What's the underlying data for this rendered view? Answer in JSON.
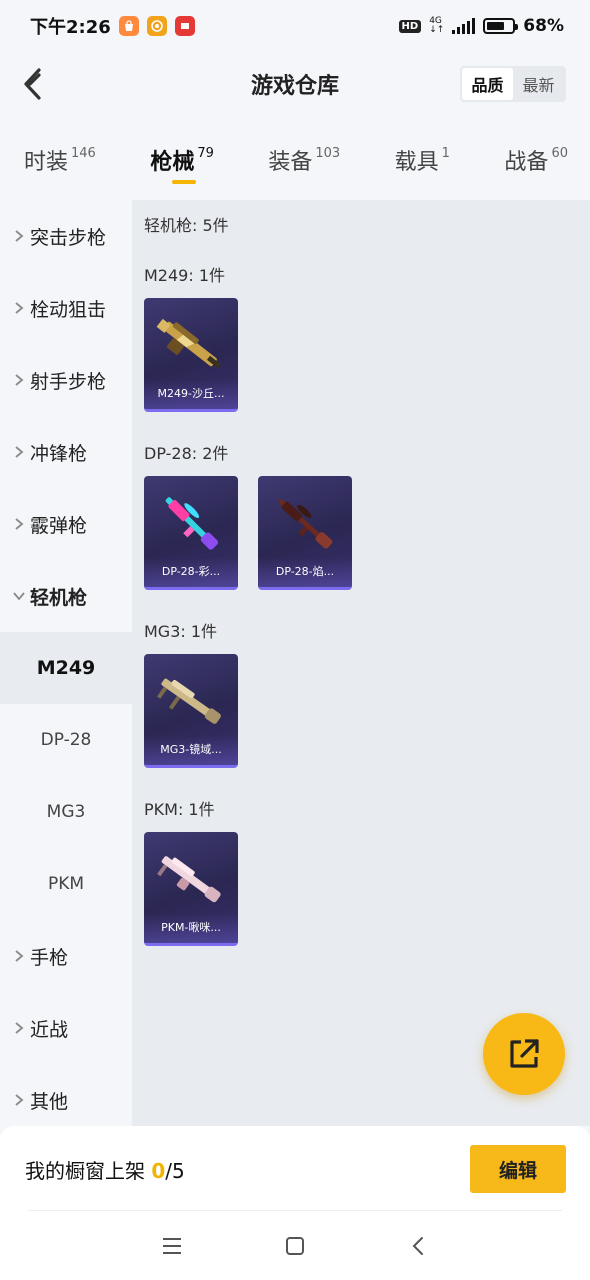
{
  "status_bar": {
    "time": "下午2:26",
    "net_top": "4G",
    "net_bottom": "↓↑",
    "hd": "HD",
    "battery": "68%",
    "battery_level": 0.68,
    "apps": [
      {
        "icon": "shopping-bag-app-icon",
        "label": "",
        "color": "#ff8a3d"
      },
      {
        "icon": "spiral-app-icon",
        "label": "",
        "color": "#f2a21b"
      },
      {
        "icon": "news-app-icon",
        "label": "",
        "color": "#e53935"
      }
    ]
  },
  "header": {
    "title": "游戏仓库",
    "back_icon": "back-arrow-icon",
    "sort_options": [
      "品质",
      "最新"
    ],
    "sort_active": "品质"
  },
  "category_tabs": [
    {
      "label": "时装",
      "count": "146",
      "active": false
    },
    {
      "label": "枪械",
      "count": "79",
      "active": true
    },
    {
      "label": "装备",
      "count": "103",
      "active": false
    },
    {
      "label": "载具",
      "count": "1",
      "active": false
    },
    {
      "label": "战备",
      "count": "60",
      "active": false
    }
  ],
  "sidebar": {
    "items": [
      {
        "label": "突击步枪"
      },
      {
        "label": "栓动狙击"
      },
      {
        "label": "射手步枪"
      },
      {
        "label": "冲锋枪"
      },
      {
        "label": "霰弹枪"
      },
      {
        "label": "轻机枪"
      },
      {
        "label": "M249"
      },
      {
        "label": "DP-28"
      },
      {
        "label": "MG3"
      },
      {
        "label": "PKM"
      },
      {
        "label": "手枪"
      },
      {
        "label": "近战"
      },
      {
        "label": "其他"
      }
    ]
  },
  "content": {
    "summary": "轻机枪: 5件",
    "groups": [
      {
        "title": "M249: 1件",
        "items": [
          {
            "name": "M249-沙丘..."
          }
        ]
      },
      {
        "title": "DP-28: 2件",
        "items": [
          {
            "name": "DP-28-彩..."
          },
          {
            "name": "DP-28-焰..."
          }
        ]
      },
      {
        "title": "MG3: 1件",
        "items": [
          {
            "name": "MG3-镜域..."
          }
        ]
      },
      {
        "title": "PKM: 1件",
        "items": [
          {
            "name": "PKM-啾咪..."
          }
        ]
      }
    ]
  },
  "fab": {
    "icon": "share-external-icon",
    "color": "#f8b815"
  },
  "bottom_bar": {
    "showcase_label": "我的橱窗上架",
    "showcase_current": "0",
    "showcase_total": "/5",
    "edit_label": "编辑"
  },
  "nav_bar": {
    "buttons": [
      "menu-icon",
      "home-square-icon",
      "back-chevron-icon"
    ]
  },
  "colors": {
    "accent": "#f5b400",
    "card_bg": "#2b2752",
    "card_border": "#7c6cf0"
  }
}
